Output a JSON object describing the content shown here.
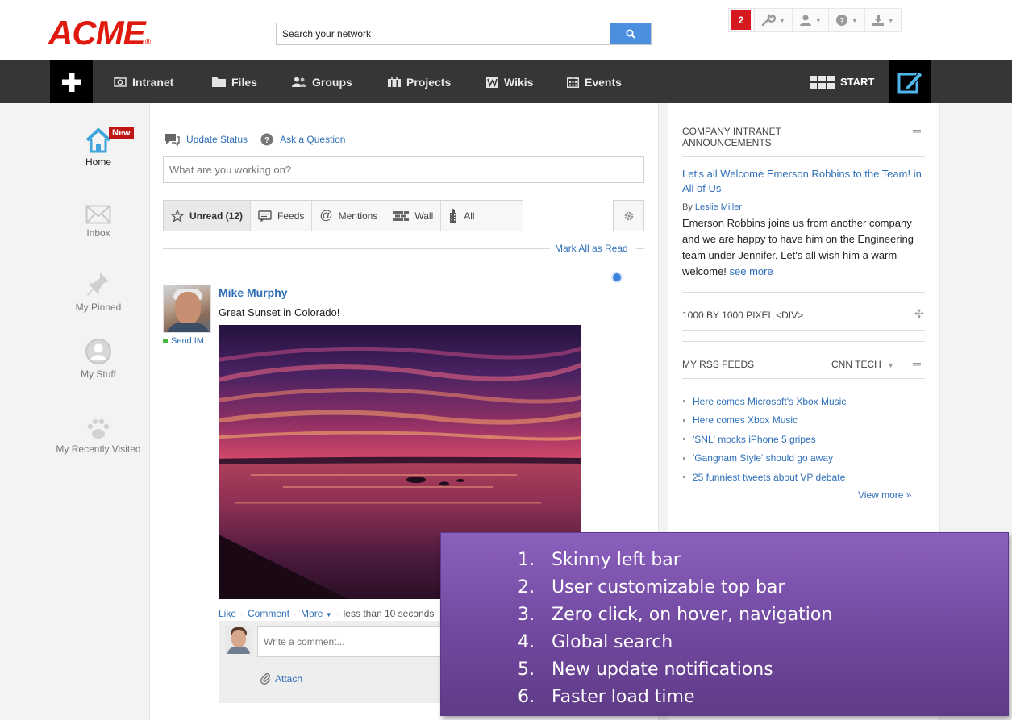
{
  "header": {
    "logo": "ACME",
    "logo_mark": "®",
    "search_placeholder": "Search your network",
    "notifications_count": "2",
    "utility_icons": [
      "wrench-icon",
      "user-icon",
      "help-icon",
      "download-icon"
    ]
  },
  "nav": {
    "items": [
      {
        "label": "Intranet",
        "icon": "intranet-icon"
      },
      {
        "label": "Files",
        "icon": "folder-icon"
      },
      {
        "label": "Groups",
        "icon": "groups-icon"
      },
      {
        "label": "Projects",
        "icon": "briefcase-icon"
      },
      {
        "label": "Wikis",
        "icon": "wiki-icon"
      },
      {
        "label": "Events",
        "icon": "calendar-icon"
      }
    ],
    "start_label": "START"
  },
  "rail": {
    "new_badge": "New",
    "items": [
      {
        "label": "Home",
        "icon": "home-icon"
      },
      {
        "label": "Inbox",
        "icon": "envelope-icon"
      },
      {
        "label": "My Pinned",
        "icon": "pin-icon"
      },
      {
        "label": "My Stuff",
        "icon": "person-circle-icon"
      },
      {
        "label": "My Recently Visited",
        "icon": "paw-icon"
      }
    ]
  },
  "composer": {
    "tabs": [
      "Update Status",
      "Ask a Question"
    ],
    "placeholder": "What are you working on?"
  },
  "filters": {
    "tabs": [
      {
        "label": "Unread (12)",
        "icon": "star-icon",
        "active": true
      },
      {
        "label": "Feeds",
        "icon": "feed-icon",
        "active": false
      },
      {
        "label": "Mentions",
        "icon": "at-icon",
        "active": false
      },
      {
        "label": "Wall",
        "icon": "wall-icon",
        "active": false
      },
      {
        "label": "All",
        "icon": "building-icon",
        "active": false
      }
    ],
    "mark_all": "Mark All as Read"
  },
  "post": {
    "author": "Mike Murphy",
    "send_im": "Send IM",
    "text": "Great Sunset in Colorado!",
    "actions": [
      "Like",
      "Comment",
      "More"
    ],
    "time": "less than 10 seconds",
    "comment_placeholder": "Write a comment...",
    "attach": "Attach"
  },
  "sidebar": {
    "announcements_title_1": "COMPANY INTRANET",
    "announcements_title_2": "ANNOUNCEMENTS",
    "ann_headline": "Let's all Welcome Emerson Robbins to the Team!",
    "ann_in": " in ",
    "ann_group": "All of Us",
    "ann_by_label": "By ",
    "ann_author": "Leslie Miller",
    "ann_body": "Emerson Robbins joins us from another company and we are happy to have him on the Engineering team under Jennifer. Let's all wish him a warm welcome! ",
    "ann_see_more": "see more",
    "div_widget": "1000 BY 1000 PIXEL <DIV>",
    "rss_title": "MY RSS FEEDS",
    "rss_source": "CNN TECH",
    "rss_items": [
      "Here comes Microsoft's Xbox Music",
      "Here comes Xbox Music",
      "'SNL' mocks iPhone 5 gripes",
      "'Gangnam Style' should go away",
      "25 funniest tweets about VP debate"
    ],
    "view_more": "View more »"
  },
  "callout": {
    "items": [
      "Skinny left bar",
      "User customizable top bar",
      "Zero click, on hover, navigation",
      "Global search",
      "New update notifications",
      "Faster load time"
    ]
  }
}
